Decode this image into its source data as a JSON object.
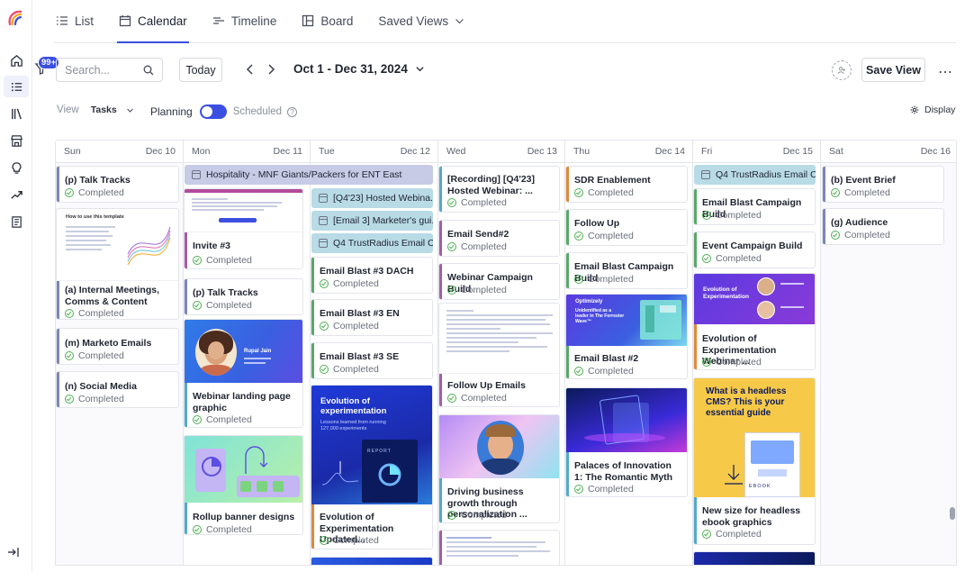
{
  "nav": {
    "badge": "99+",
    "items": [
      "home-icon",
      "list-icon",
      "library-icon",
      "store-icon",
      "lightbulb-icon",
      "trend-icon",
      "document-icon"
    ]
  },
  "tabs": [
    {
      "label": "List",
      "icon": "list-icon"
    },
    {
      "label": "Calendar",
      "icon": "calendar-icon",
      "active": true
    },
    {
      "label": "Timeline",
      "icon": "timeline-icon"
    },
    {
      "label": "Board",
      "icon": "board-icon"
    },
    {
      "label": "Saved Views",
      "icon": "chevron-down-icon"
    }
  ],
  "toolbar": {
    "search_placeholder": "Search...",
    "today": "Today",
    "range": "Oct 1 - Dec 31, 2024",
    "save_view": "Save View"
  },
  "options": {
    "view_label": "View",
    "view_value": "Tasks",
    "planning": "Planning",
    "scheduled": "Scheduled",
    "display": "Display"
  },
  "status": "Completed",
  "days": [
    {
      "name": "Sun",
      "date": "Dec 10"
    },
    {
      "name": "Mon",
      "date": "Dec 11"
    },
    {
      "name": "Tue",
      "date": "Dec 12"
    },
    {
      "name": "Wed",
      "date": "Dec 13"
    },
    {
      "name": "Thu",
      "date": "Dec 14"
    },
    {
      "name": "Fri",
      "date": "Dec 15"
    },
    {
      "name": "Sat",
      "date": "Dec 16"
    }
  ],
  "pills": {
    "hospitality": "Hospitality - MNF Giants/Packers for ENT East",
    "tue1": "[Q4'23] Hosted Webina...",
    "tue2": "[Email 3] Marketer's gui...",
    "tue3": "Q4 TrustRadius Email C...",
    "fri1": "Q4 TrustRadius Email C..."
  },
  "cards": {
    "sun": [
      "(p) Talk Tracks",
      "(a) Internal Meetings, Comms & Content",
      "(m) Marketo Emails",
      "(n) Social Media"
    ],
    "mon": [
      "Invite #3",
      "(p) Talk Tracks",
      "Webinar landing page graphic",
      "Rollup banner designs"
    ],
    "tue": [
      "Email Blast #3 DACH",
      "Email Blast #3 EN",
      "Email Blast #3 SE",
      "Evolution of Experimentation Updated..."
    ],
    "wed": [
      "[Recording] [Q4'23] Hosted Webinar: ...",
      "Email Send#2",
      "Webinar Campaign Build",
      "Follow Up Emails",
      "Driving business growth through personalization ..."
    ],
    "thu": [
      "SDR Enablement",
      "Follow Up",
      "Email Blast Campaign Build",
      "Email Blast #2",
      "Palaces of Innovation 1: The Romantic Myth"
    ],
    "fri": [
      "Email Blast Campaign Build",
      "Event Campaign Build",
      "Evolution of Experimentation Webinar ...",
      "New size for headless ebook graphics"
    ],
    "sat": [
      "(b) Event Brief",
      "(g) Audience"
    ]
  },
  "thumbs": {
    "template_title": "How to use this template",
    "report_title": "Evolution of experimentation",
    "report_sub": "Lessons learned from running 127,000 experiments",
    "report_tag": "REPORT",
    "optimizely": "Optimizely",
    "forrester": "Unidentified as a leader in The Forrester Wave™",
    "fri_thumb_title": "Evolution of Experimentation",
    "cms_title": "What is a headless CMS? This is your essential guide",
    "ebook": "EBOOK",
    "mon_speaker": "Rupal Jain"
  }
}
